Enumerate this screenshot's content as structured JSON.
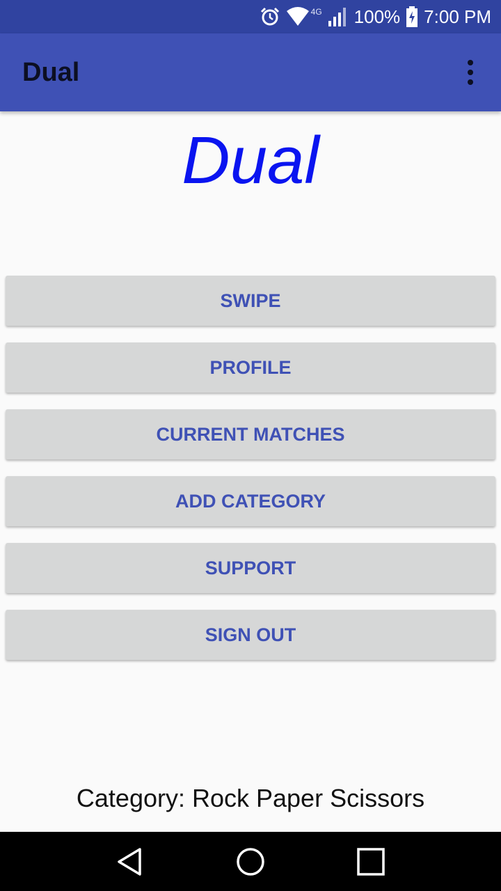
{
  "status_bar": {
    "network": "4G",
    "battery": "100%",
    "time": "7:00 PM",
    "icons": [
      "alarm-icon",
      "wifi-icon",
      "signal-icon",
      "battery-charging-icon"
    ]
  },
  "app_bar": {
    "title": "Dual",
    "overflow_icon": "more-vert-icon"
  },
  "brand": {
    "text": "Dual",
    "color": "#0a14f0"
  },
  "menu": {
    "swipe": "SWIPE",
    "profile": "PROFILE",
    "current_matches": "CURRENT MATCHES",
    "add_category": "ADD CATEGORY",
    "support": "SUPPORT",
    "sign_out": "SIGN OUT"
  },
  "category_label": "Category: Rock Paper Scissors",
  "nav_bar": {
    "icons": [
      "back-icon",
      "home-icon",
      "recents-icon"
    ]
  },
  "colors": {
    "primary": "#3f51b5",
    "primary_dark": "#3043a0",
    "button_bg": "#d6d7d7"
  }
}
